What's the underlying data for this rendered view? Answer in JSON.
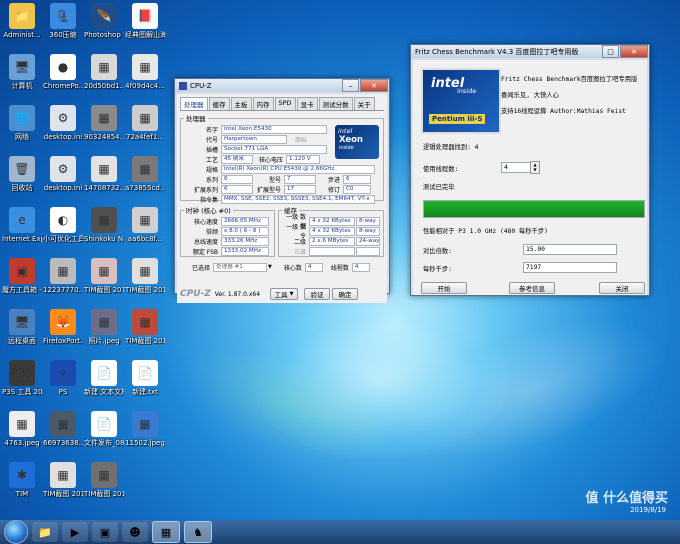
{
  "desktop": {
    "icons": [
      {
        "label": "Administ...",
        "glyph": "📁",
        "bg": "#f0c44c"
      },
      {
        "label": "360压缩",
        "glyph": "🗜",
        "bg": "#3c8be0"
      },
      {
        "label": "Photoshop 7.0",
        "glyph": "🪶",
        "bg": "#1e4d8a"
      },
      {
        "label": "经典图解山海经：图...",
        "glyph": "📕",
        "bg": "#fafafa"
      },
      {
        "label": "计算机",
        "glyph": "🖥",
        "bg": "#6aa0d8"
      },
      {
        "label": "ChromePo...",
        "glyph": "●",
        "bg": "#ffffff"
      },
      {
        "label": "20d50bd1...",
        "glyph": "▦",
        "bg": "#d8d8d8"
      },
      {
        "label": "4f09d4c4...",
        "glyph": "▦",
        "bg": "#e8e8e8"
      },
      {
        "label": "网络",
        "glyph": "🌐",
        "bg": "#4c8ed0"
      },
      {
        "label": "desktop.ini",
        "glyph": "⚙",
        "bg": "#dde4ec"
      },
      {
        "label": "90324854...",
        "glyph": "▦",
        "bg": "#8a8a8a"
      },
      {
        "label": "72a4fef1...",
        "glyph": "▦",
        "bg": "#cccccc"
      },
      {
        "label": "回收站",
        "glyph": "🗑",
        "bg": "#9fb6cf"
      },
      {
        "label": "desktop.ini",
        "glyph": "⚙",
        "bg": "#dde4ec"
      },
      {
        "label": "14708732...",
        "glyph": "▦",
        "bg": "#e2e2e2"
      },
      {
        "label": "a73855cd...",
        "glyph": "▦",
        "bg": "#7a7a7a"
      },
      {
        "label": "Internet Explorer",
        "glyph": "e",
        "bg": "#3b8fe0"
      },
      {
        "label": "小可优化工具 - 快捷方式",
        "glyph": "◐",
        "bg": "#ffffff"
      },
      {
        "label": "Shinkoku Nadeko...",
        "glyph": "▦",
        "bg": "#505050"
      },
      {
        "label": "aa6bc8f...",
        "glyph": "▦",
        "bg": "#d0d0d0"
      },
      {
        "label": "魔方工具箱 - 快捷方式",
        "glyph": "▣",
        "bg": "#c03b2b"
      },
      {
        "label": "12237770...",
        "glyph": "▦",
        "bg": "#bbbbbb"
      },
      {
        "label": "TIM截图 20190804...",
        "glyph": "▦",
        "bg": "#d8c0c0"
      },
      {
        "label": "TIM截图 20190804...",
        "glyph": "▦",
        "bg": "#e0e0e0"
      },
      {
        "label": "远程桌面",
        "glyph": "🖥",
        "bg": "#4a7fc0"
      },
      {
        "label": "FirefoxPort...",
        "glyph": "🦊",
        "bg": "#ff8c1a"
      },
      {
        "label": "照片.jpeg",
        "glyph": "▦",
        "bg": "#6d6d8a"
      },
      {
        "label": "TIM截图 2019...",
        "glyph": "▦",
        "bg": "#c04a3a"
      },
      {
        "label": "P3S 工具 2019",
        "glyph": "P3S",
        "bg": "#3a3a3a"
      },
      {
        "label": "PS",
        "glyph": "✧",
        "bg": "#1a4bb0"
      },
      {
        "label": "新建 文本文档 Notes",
        "glyph": "📄",
        "bg": "#ffffff"
      },
      {
        "label": "新建.txt",
        "glyph": "📄",
        "bg": "#ffffff"
      },
      {
        "label": "4763.jpeg",
        "glyph": "▦",
        "bg": "#eeeeee"
      },
      {
        "label": "66973638...",
        "glyph": "▦",
        "bg": "#4a5a6a"
      },
      {
        "label": "文件发布_0803...",
        "glyph": "📄",
        "bg": "#ffffff"
      },
      {
        "label": "11502.jpeg",
        "glyph": "▦",
        "bg": "#3a7ad0"
      },
      {
        "label": "TIM",
        "glyph": "✱",
        "bg": "#1f6ed8"
      },
      {
        "label": "TIM截图 20190804...",
        "glyph": "▦",
        "bg": "#e0e0e0"
      },
      {
        "label": "TIM截图 20190804...",
        "glyph": "▦",
        "bg": "#707070"
      }
    ],
    "date": "2019/8/19",
    "watermark": "值 什么值得买"
  },
  "cpuz": {
    "title": "CPU-Z",
    "tabs": [
      "处理器",
      "缓存",
      "主板",
      "内存",
      "SPD",
      "显卡",
      "测试分数",
      "关于"
    ],
    "processor_legend": "处理器",
    "name_label": "名字",
    "name": "Intel Xeon E5430",
    "codename_label": "代号",
    "codename": "Harpertown",
    "brand_label": "商标",
    "package_label": "插槽",
    "package": "Socket 771 LGA",
    "tech_label": "工艺",
    "tech": "45 纳米",
    "voltage_label": "核心电压",
    "voltage": "1.120 V",
    "spec_label": "规格",
    "spec": "Intel(R) Xeon(R) CPU     E5430  @ 2.66GHz",
    "family_label": "系列",
    "family": "6",
    "model_label": "型号",
    "model": "7",
    "stepping_label": "步进",
    "stepping": "6",
    "extfamily_label": "扩展系列",
    "extfamily": "6",
    "extmodel_label": "扩展型号",
    "extmodel": "17",
    "revision_label": "修订",
    "revision": "C0",
    "instr_label": "指令集",
    "instr": "MMX, SSE, SSE2, SSE3, SSSE3, SSE4.1, EM64T, VT-x",
    "clocks_legend": "时钟 (核心 #0)",
    "corespeed_label": "核心速度",
    "corespeed": "2666.05 MHz",
    "multiplier_label": "倍频",
    "multiplier": "x 8.0 ( 6 - 8 )",
    "busspeed_label": "总线速度",
    "busspeed": "333.26 MHz",
    "fsb_label": "额定 FSB",
    "fsb": "1333.02 MHz",
    "cache_legend": "缓存",
    "l1d_label": "一级 数据",
    "l1d": "4 x 32 KBytes",
    "l1d_way": "8-way",
    "l1i_label": "一级 指令",
    "l1i": "4 x 32 KBytes",
    "l1i_way": "8-way",
    "l2_label": "二级",
    "l2": "2 x 6 MBytes",
    "l2_way": "24-way",
    "l3_label": "三级",
    "selected_label": "已选择",
    "selected": "处理器 #1",
    "cores_label": "核心数",
    "cores": "4",
    "threads_label": "线程数",
    "threads": "4",
    "logo": "CPU-Z",
    "version": "Ver. 1.87.0.x64",
    "tools_btn": "工具",
    "validate_btn": "验证",
    "ok_btn": "确定",
    "badge_brand": "intel",
    "badge_inside": "inside",
    "badge_product": "Xeon"
  },
  "fritz": {
    "title": "Fritz Chess Benchmark V4.3  百度图拉丁吧专用版",
    "header_line1": "Fritz Chess Benchmark百度图拉丁吧专用版",
    "header_line2": "喜闻乐见, 大快人心",
    "header_line3": "支持16线程运算   Author:Mathias Feist",
    "badge_brand": "intel",
    "badge_inside": "inside",
    "badge_product": "Pentium iii-S",
    "logical_cpus_label": "逻辑处理器找到: 4",
    "threads_label": "使用线程数:",
    "threads_value": "4",
    "status": "测试已完毕",
    "progress_fraction": 1.0,
    "relative_label": "性能相对于 P3 1.0 GHz (480 每秒千步)",
    "ratio_label": "对比倍数:",
    "ratio_value": "15.00",
    "knps_label": "每秒千步:",
    "knps_value": "7197",
    "start_btn": "开始",
    "ref_btn": "参考信息",
    "close_btn": "关闭"
  },
  "colors": {
    "accent": "#1d3d9c",
    "progress": "#22b52e"
  }
}
